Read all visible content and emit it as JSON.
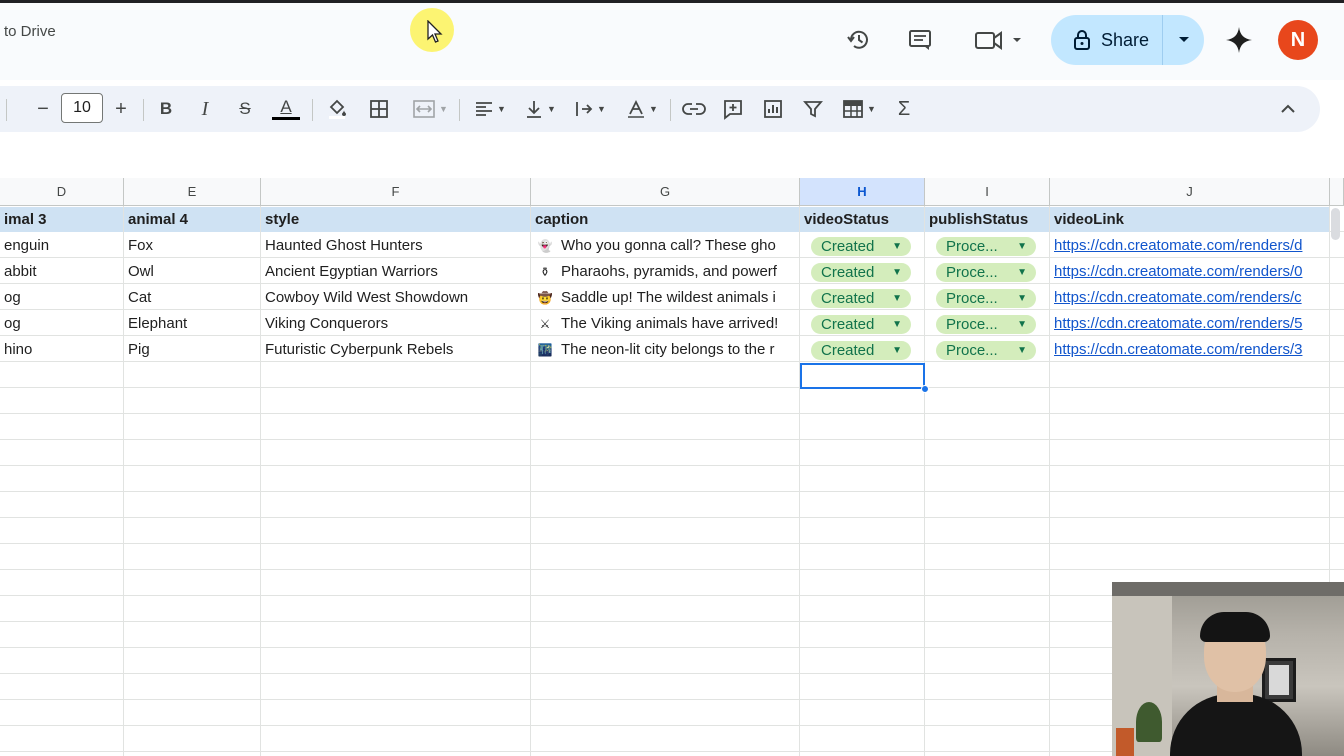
{
  "topbar": {
    "doc_status": "to Drive",
    "share_label": "Share",
    "avatar_initial": "N",
    "icons": [
      "history-icon",
      "comment-icon",
      "meet-icon",
      "gemini-icon"
    ]
  },
  "toolbar": {
    "font_size": "10",
    "minus": "−",
    "plus": "+",
    "bold": "B",
    "italic": "I",
    "strikethrough": "S",
    "text_color": "A",
    "sum": "Σ"
  },
  "grid": {
    "columns": [
      {
        "letter": "D",
        "selected": false
      },
      {
        "letter": "E",
        "selected": false
      },
      {
        "letter": "F",
        "selected": false
      },
      {
        "letter": "G",
        "selected": false
      },
      {
        "letter": "H",
        "selected": true
      },
      {
        "letter": "I",
        "selected": false
      },
      {
        "letter": "J",
        "selected": false
      }
    ],
    "headers": [
      "imal 3",
      "animal 4",
      "style",
      "caption",
      "videoStatus",
      "publishStatus",
      "videoLink"
    ],
    "rows": [
      {
        "animal3": "enguin",
        "animal4": "Fox",
        "style": "Haunted Ghost Hunters",
        "caption_emoji": "👻",
        "caption": "Who you gonna call? These gho",
        "videoStatus": "Created",
        "publishStatus": "Proce...",
        "videoLink": "https://cdn.creatomate.com/renders/d"
      },
      {
        "animal3": "abbit",
        "animal4": "Owl",
        "style": "Ancient Egyptian Warriors",
        "caption_emoji": "⚱",
        "caption": "Pharaohs, pyramids, and powerf",
        "videoStatus": "Created",
        "publishStatus": "Proce...",
        "videoLink": "https://cdn.creatomate.com/renders/0"
      },
      {
        "animal3": "og",
        "animal4": "Cat",
        "style": "Cowboy Wild West Showdown",
        "caption_emoji": "🤠",
        "caption": "Saddle up! The wildest animals i",
        "videoStatus": "Created",
        "publishStatus": "Proce...",
        "videoLink": "https://cdn.creatomate.com/renders/c"
      },
      {
        "animal3": "og",
        "animal4": "Elephant",
        "style": "Viking Conquerors",
        "caption_emoji": "⚔",
        "caption": "The Viking animals have arrived!",
        "videoStatus": "Created",
        "publishStatus": "Proce...",
        "videoLink": "https://cdn.creatomate.com/renders/5"
      },
      {
        "animal3": "hino",
        "animal4": "Pig",
        "style": "Futuristic Cyberpunk Rebels",
        "caption_emoji": "🌃",
        "caption": "The neon-lit city belongs to the r",
        "videoStatus": "Created",
        "publishStatus": "Proce...",
        "videoLink": "https://cdn.creatomate.com/renders/3"
      }
    ]
  },
  "colors": {
    "share_bg": "#c2e7ff",
    "avatar_bg": "#e8471c",
    "header_row_bg": "#cfe2f3",
    "chip_bg": "#d4edbc",
    "chip_text": "#11734b",
    "link": "#1155cc",
    "selection": "#1a73e8"
  }
}
